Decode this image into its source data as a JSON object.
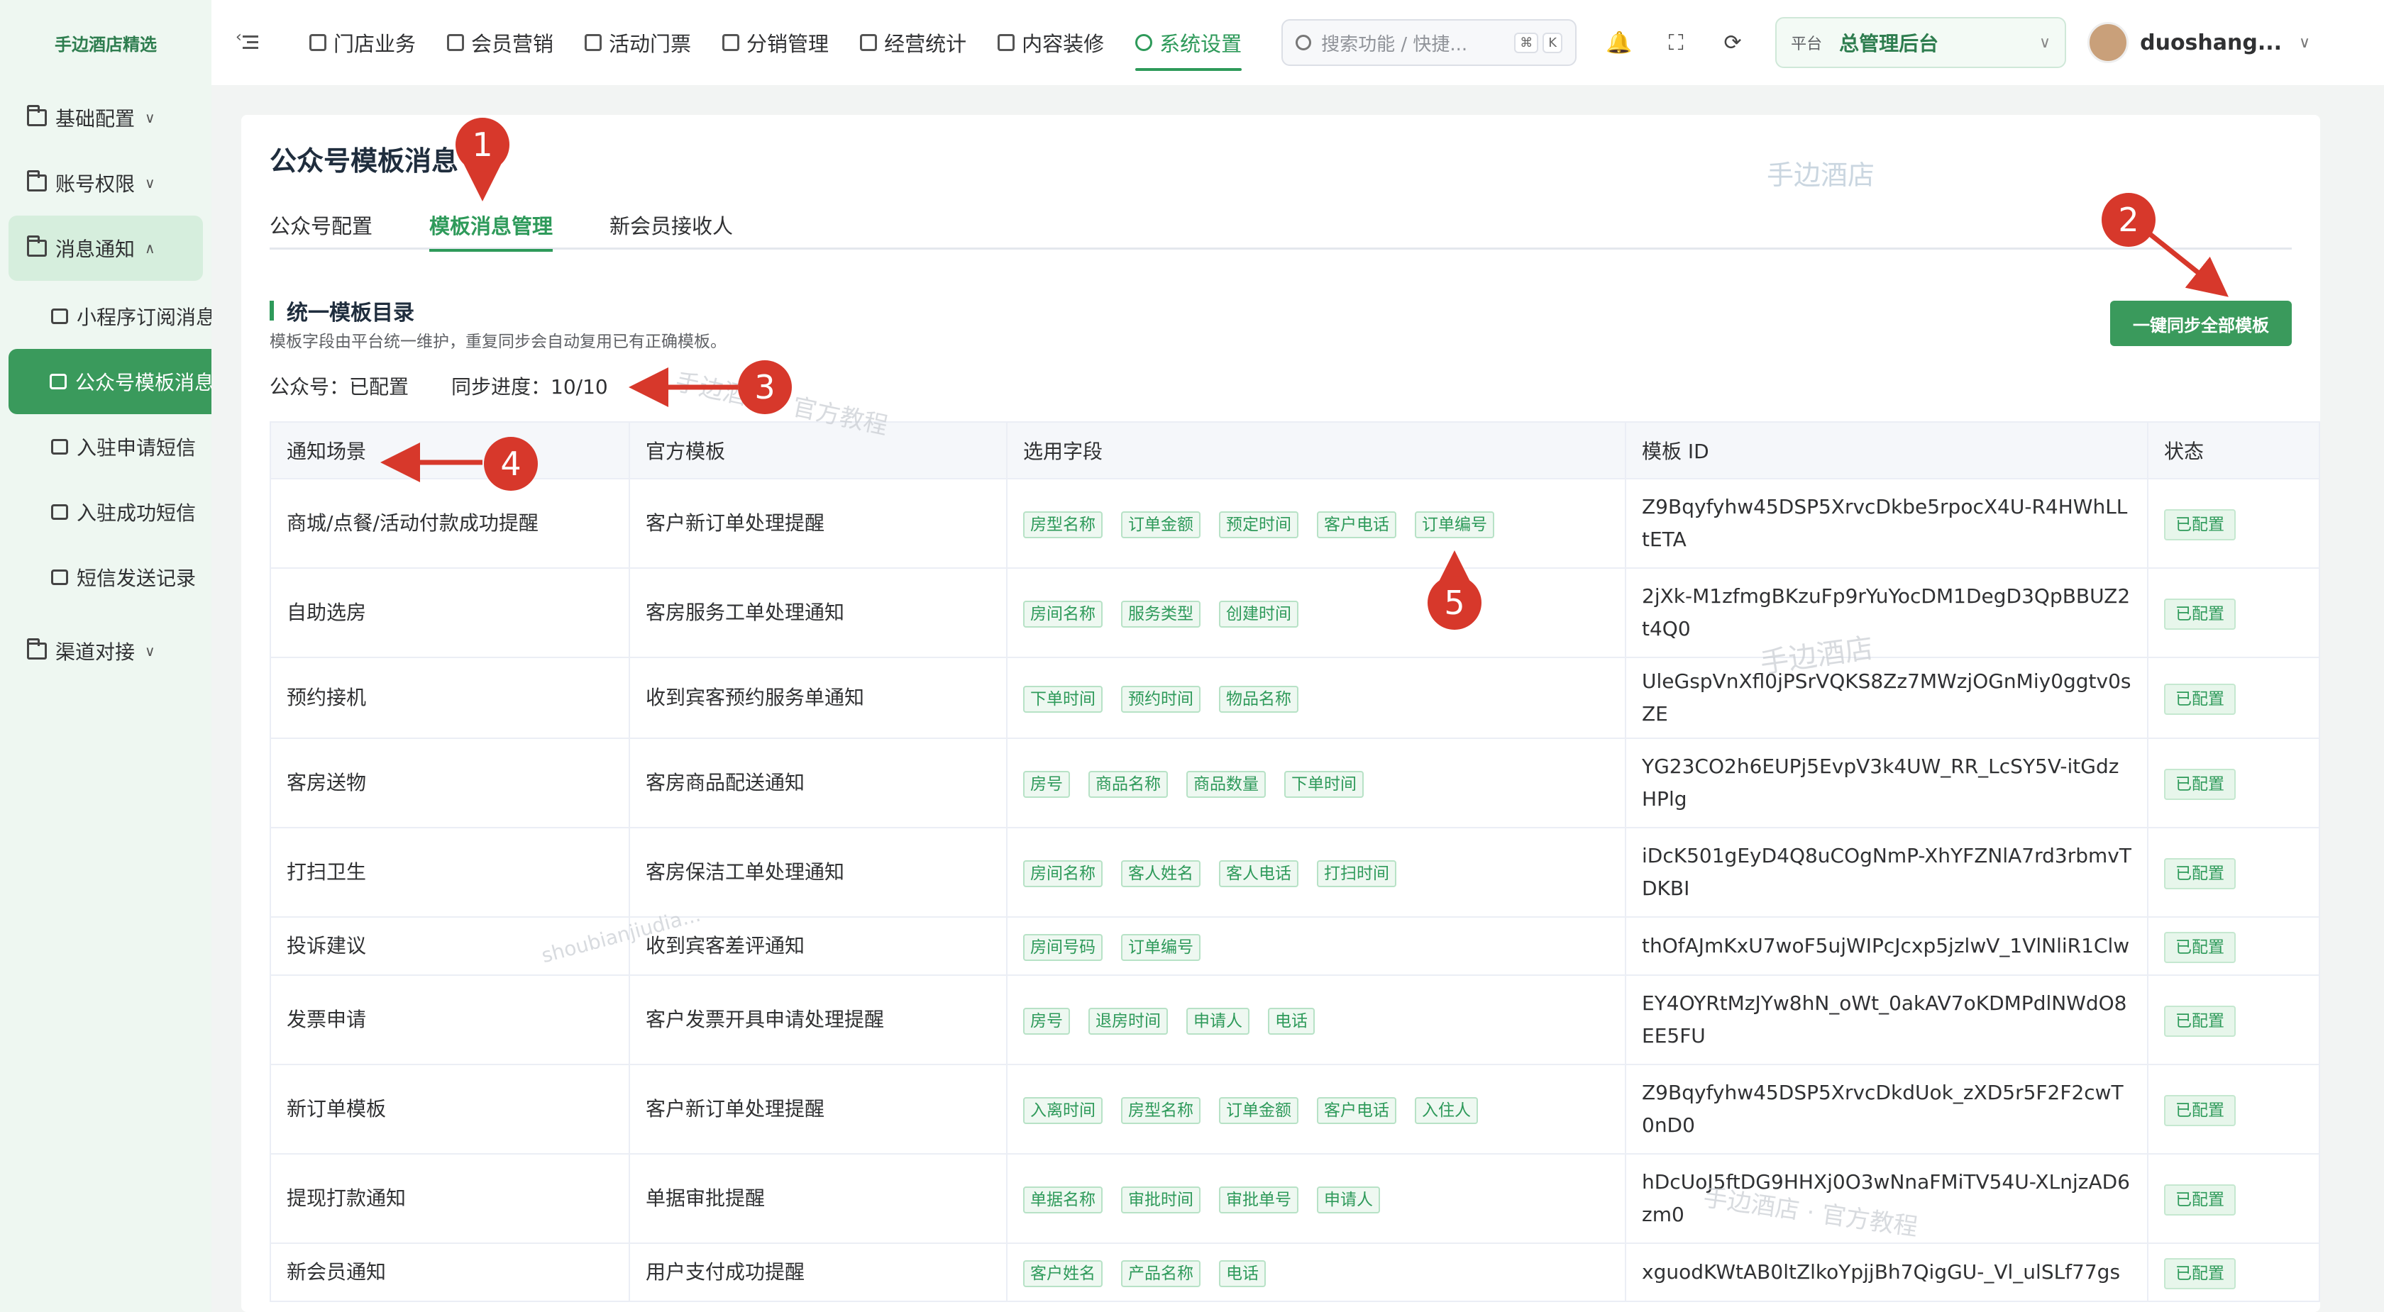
{
  "sidebar": {
    "brand": "手边酒店精选",
    "groups": [
      {
        "label": "基础配置",
        "chevron": "∨"
      },
      {
        "label": "账号权限",
        "chevron": "∨"
      },
      {
        "label": "消息通知",
        "chevron": "∧"
      },
      {
        "label": "渠道对接",
        "chevron": "∨"
      }
    ],
    "sub_items": [
      {
        "label": "小程序订阅消息"
      },
      {
        "label": "公众号模板消息"
      },
      {
        "label": "入驻申请短信"
      },
      {
        "label": "入驻成功短信"
      },
      {
        "label": "短信发送记录"
      }
    ]
  },
  "topbar": {
    "nav": [
      {
        "label": "门店业务"
      },
      {
        "label": "会员营销"
      },
      {
        "label": "活动门票"
      },
      {
        "label": "分销管理"
      },
      {
        "label": "经营统计"
      },
      {
        "label": "内容装修"
      },
      {
        "label": "系统设置"
      }
    ],
    "search_placeholder": "搜索功能 / 快捷...",
    "kbd1": "⌘",
    "kbd2": "K",
    "platform_label": "平台",
    "platform_value": "总管理后台",
    "username": "duoshang..."
  },
  "page": {
    "title": "公众号模板消息",
    "tabs": [
      {
        "label": "公众号配置"
      },
      {
        "label": "模板消息管理"
      },
      {
        "label": "新会员接收人"
      }
    ],
    "section_title": "统一模板目录",
    "section_desc": "模板字段由平台统一维护，重复同步会自动复用已有正确模板。",
    "account_status": "公众号：已配置",
    "sync_progress": "同步进度：10/10",
    "sync_button": "一键同步全部模板"
  },
  "table": {
    "headers": [
      "通知场景",
      "官方模板",
      "选用字段",
      "模板 ID",
      "状态"
    ],
    "rows": [
      {
        "scene": "商城/点餐/活动付款成功提醒",
        "template": "客户新订单处理提醒",
        "fields": [
          "房型名称",
          "订单金额",
          "预定时间",
          "客户电话",
          "订单编号"
        ],
        "tid": "Z9Bqyfyhw45DSP5XrvcDkbe5rpocX4U-R4HWhLLtETA",
        "status": "已配置"
      },
      {
        "scene": "自助选房",
        "template": "客房服务工单处理通知",
        "fields": [
          "房间名称",
          "服务类型",
          "创建时间"
        ],
        "tid": "2jXk-M1zfmgBKzuFp9rYuYocDM1DegD3QpBBUZ2t4Q0",
        "status": "已配置"
      },
      {
        "scene": "预约接机",
        "template": "收到宾客预约服务单通知",
        "fields": [
          "下单时间",
          "预约时间",
          "物品名称"
        ],
        "tid": "UleGspVnXfl0jPSrVQKS8Zz7MWzjOGnMiy0ggtv0sZE",
        "status": "已配置"
      },
      {
        "scene": "客房送物",
        "template": "客房商品配送通知",
        "fields": [
          "房号",
          "商品名称",
          "商品数量",
          "下单时间"
        ],
        "tid": "YG23CO2h6EUPj5EvpV3k4UW_RR_LcSY5V-itGdzHPlg",
        "status": "已配置"
      },
      {
        "scene": "打扫卫生",
        "template": "客房保洁工单处理通知",
        "fields": [
          "房间名称",
          "客人姓名",
          "客人电话",
          "打扫时间"
        ],
        "tid": "iDcK501gEyD4Q8uCOgNmP-XhYFZNlA7rd3rbmvTDKBI",
        "status": "已配置"
      },
      {
        "scene": "投诉建议",
        "template": "收到宾客差评通知",
        "fields": [
          "房间号码",
          "订单编号"
        ],
        "tid": "thOfAJmKxU7woF5ujWIPcJcxp5jzlwV_1VlNliR1Clw",
        "status": "已配置"
      },
      {
        "scene": "发票申请",
        "template": "客户发票开具申请处理提醒",
        "fields": [
          "房号",
          "退房时间",
          "申请人",
          "电话"
        ],
        "tid": "EY4OYRtMzJYw8hN_oWt_0akAV7oKDMPdlNWdO8EE5FU",
        "status": "已配置"
      },
      {
        "scene": "新订单模板",
        "template": "客户新订单处理提醒",
        "fields": [
          "入离时间",
          "房型名称",
          "订单金额",
          "客户电话",
          "入住人"
        ],
        "tid": "Z9Bqyfyhw45DSP5XrvcDkdUok_zXD5r5F2F2cwT0nD0",
        "status": "已配置"
      },
      {
        "scene": "提现打款通知",
        "template": "单据审批提醒",
        "fields": [
          "单据名称",
          "审批时间",
          "审批单号",
          "申请人"
        ],
        "tid": "hDcUoJ5ftDG9HHXj0O3wNnaFMiTV54U-XLnjzAD6zm0",
        "status": "已配置"
      },
      {
        "scene": "新会员通知",
        "template": "用户支付成功提醒",
        "fields": [
          "客户姓名",
          "产品名称",
          "电话"
        ],
        "tid": "xguodKWtAB0ltZlkoYpjjBh7QigGU-_Vl_ulSLf77gs",
        "status": "已配置"
      }
    ]
  },
  "annotations": [
    "1",
    "2",
    "3",
    "4",
    "5"
  ],
  "watermarks": [
    "手边酒店",
    "手边酒店 · 官方教程",
    "手边酒店",
    "shoubianjiudia...",
    "手边酒店 · 官方教程"
  ],
  "colors": {
    "accent": "#2e9a5a",
    "annotation": "#d7382b"
  }
}
